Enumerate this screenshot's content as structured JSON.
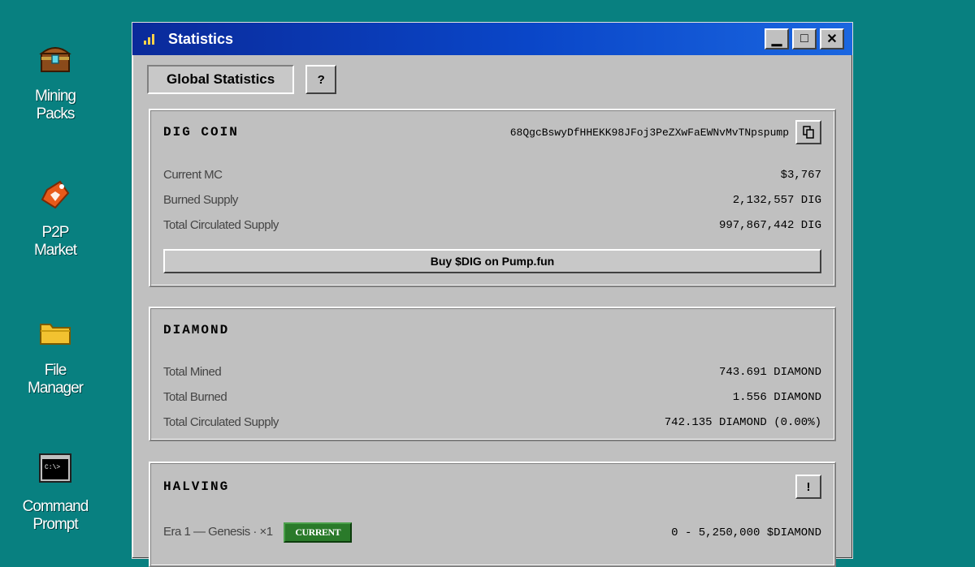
{
  "desktop": {
    "icons": [
      {
        "label": "Mining\nPacks",
        "icon": "treasure-chest-icon"
      },
      {
        "label": "P2P\nMarket",
        "icon": "diamond-tag-icon"
      },
      {
        "label": "File\nManager",
        "icon": "folder-icon"
      },
      {
        "label": "Command\nPrompt",
        "icon": "terminal-icon"
      }
    ],
    "terminal_glyph": "C:\\>"
  },
  "window": {
    "title": "Statistics",
    "controls": {
      "minimize": "▁",
      "maximize": "□",
      "close": "✕"
    }
  },
  "toolbar": {
    "tab_label": "Global Statistics",
    "help_label": "?"
  },
  "dig_coin": {
    "title": "DIG COIN",
    "address": "68QgcBswyDfHHEKK98JFoj3PeZXwFaEWNvMvTNpspump",
    "rows": [
      {
        "label": "Current MC",
        "value": "$3,767"
      },
      {
        "label": "Burned Supply",
        "value": "2,132,557 DIG"
      },
      {
        "label": "Total Circulated Supply",
        "value": "997,867,442 DIG"
      }
    ],
    "buy_label": "Buy $DIG on Pump.fun"
  },
  "diamond": {
    "title": "DIAMOND",
    "rows": [
      {
        "label": "Total Mined",
        "value": "743.691 DIAMOND"
      },
      {
        "label": "Total Burned",
        "value": "1.556 DIAMOND"
      },
      {
        "label": "Total Circulated Supply",
        "value": "742.135 DIAMOND (0.00%)"
      }
    ]
  },
  "halving": {
    "title": "HALVING",
    "info_label": "!",
    "eras": [
      {
        "label": "Era 1 — Genesis · ×1",
        "badge": "CURRENT",
        "range": "0 - 5,250,000 $DIAMOND"
      }
    ]
  },
  "colors": {
    "desktop": "#088080",
    "title_bar": "#0a46c8",
    "badge": "#2a7a2a"
  }
}
